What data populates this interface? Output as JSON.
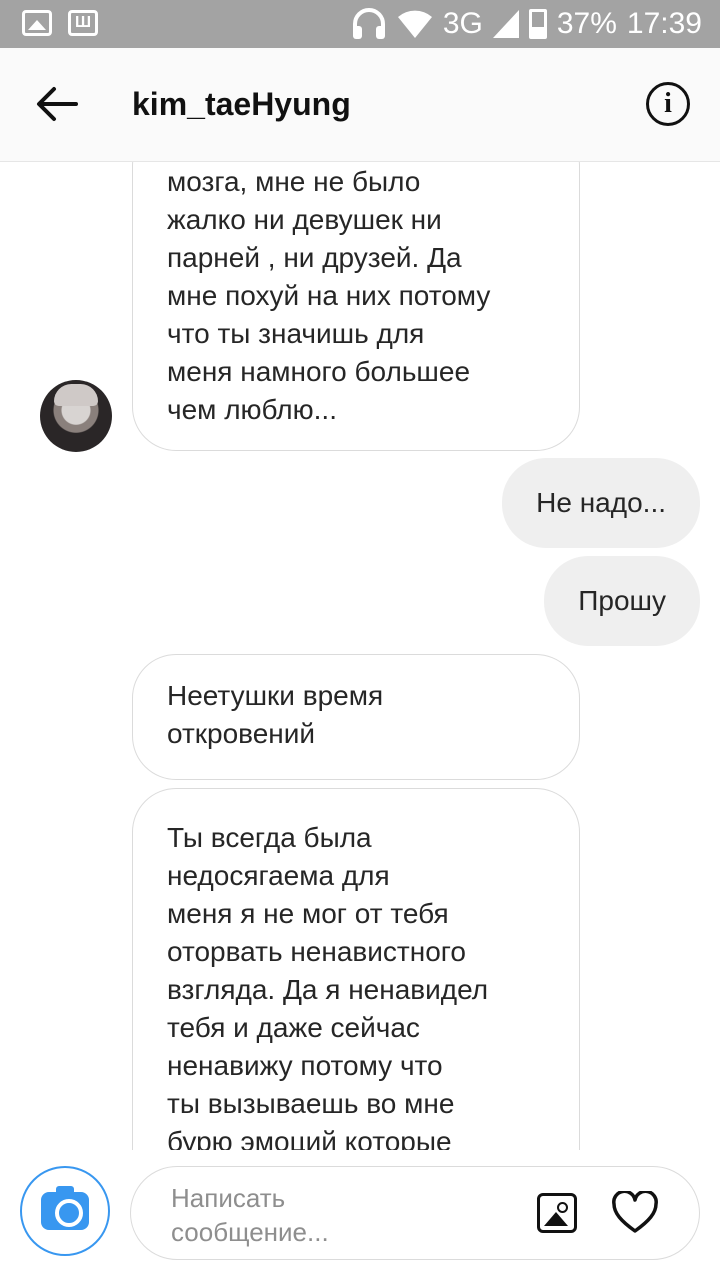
{
  "status_bar": {
    "network": "3G",
    "battery": "37%",
    "time": "17:39",
    "wmark": "Ш"
  },
  "header": {
    "username": "kim_taeHyung",
    "info_glyph": "i"
  },
  "messages": [
    {
      "direction": "incoming",
      "lines": [
        "мозга, мне не было",
        "жалко ни девушек ни",
        "парней , ни друзей. Да",
        "мне похуй на них потому",
        "что ты значишь для",
        "меня намного большее",
        "чем люблю..."
      ]
    },
    {
      "direction": "outgoing",
      "text": "Не надо..."
    },
    {
      "direction": "outgoing",
      "text": "Прошу"
    },
    {
      "direction": "incoming",
      "lines": [
        "Неетушки время",
        "откровений"
      ]
    },
    {
      "direction": "incoming",
      "lines": [
        "Ты всегда была",
        "недосягаема для",
        "меня я не мог от тебя",
        "оторвать ненавистного",
        "взгляда. Да я ненавидел",
        "тебя и даже сейчас",
        "ненавижу потому что",
        "ты вызываешь во мне",
        "бурю эмоций которые"
      ]
    }
  ],
  "composer": {
    "placeholder_line1": "Написать",
    "placeholder_line2": "сообщение..."
  },
  "colors": {
    "accent": "#3897f0",
    "status_bar": "#a3a3a3",
    "outgoing_bubble": "#efefef"
  },
  "icons": [
    "gallery-icon",
    "wmark-icon",
    "headphones-icon",
    "wifi-icon",
    "signal-icon",
    "battery-icon",
    "back-arrow-icon",
    "info-icon",
    "camera-icon",
    "image-icon",
    "heart-icon"
  ]
}
